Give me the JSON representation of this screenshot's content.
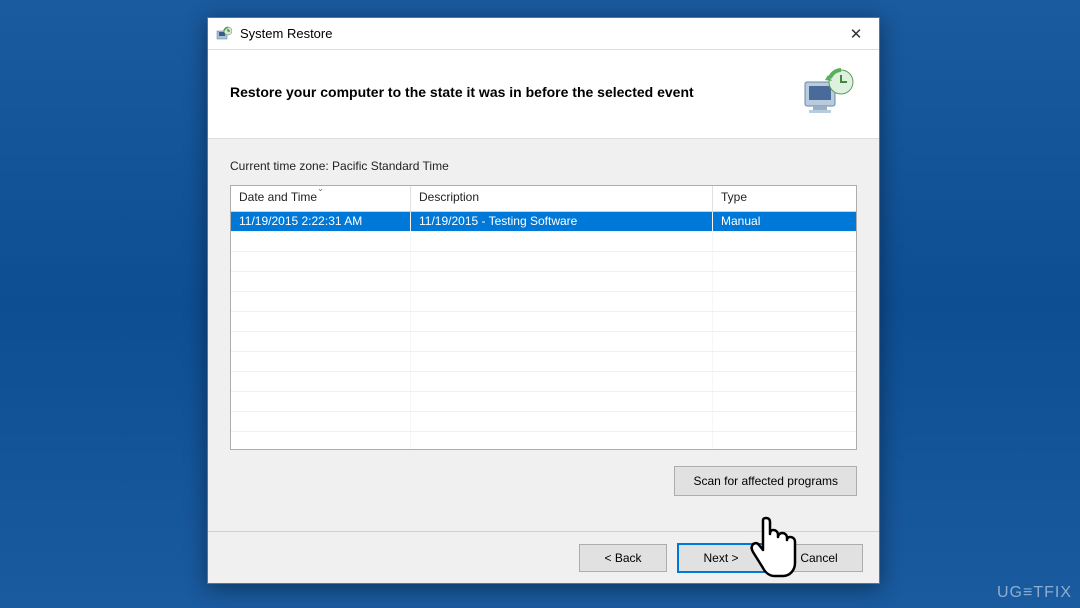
{
  "titlebar": {
    "title": "System Restore",
    "close_label": "✕"
  },
  "header": {
    "heading": "Restore your computer to the state it was in before the selected event"
  },
  "content": {
    "timezone_label": "Current time zone: Pacific Standard Time"
  },
  "table": {
    "columns": {
      "date": "Date and Time",
      "desc": "Description",
      "type": "Type"
    },
    "rows": [
      {
        "date": "11/19/2015 2:22:31 AM",
        "desc": "11/19/2015 - Testing Software",
        "type": "Manual"
      }
    ]
  },
  "buttons": {
    "scan": "Scan for affected programs",
    "back": "< Back",
    "next": "Next >",
    "cancel": "Cancel"
  },
  "watermark": "UG≡TFIX"
}
